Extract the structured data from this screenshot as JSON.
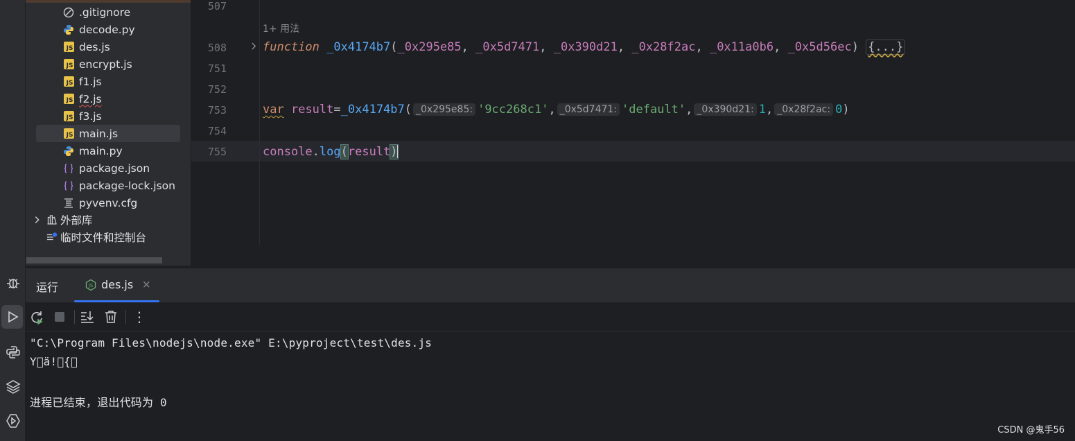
{
  "project_tree": {
    "items": [
      {
        "label": ".gitignore",
        "icon": "ignore-file-icon"
      },
      {
        "label": "decode.py",
        "icon": "python-file-icon"
      },
      {
        "label": "des.js",
        "icon": "js-file-icon"
      },
      {
        "label": "encrypt.js",
        "icon": "js-file-icon"
      },
      {
        "label": "f1.js",
        "icon": "js-file-icon"
      },
      {
        "label": "f2.js",
        "icon": "js-file-icon"
      },
      {
        "label": "f3.js",
        "icon": "js-file-icon"
      },
      {
        "label": "main.js",
        "icon": "js-file-icon",
        "selected": true
      },
      {
        "label": "main.py",
        "icon": "python-file-icon"
      },
      {
        "label": "package.json",
        "icon": "json-file-icon"
      },
      {
        "label": "package-lock.json",
        "icon": "json-file-icon"
      },
      {
        "label": "pyvenv.cfg",
        "icon": "config-file-icon"
      }
    ],
    "external_libs": "外部库",
    "scratches": "临时文件和控制台",
    "js_badge": "JS"
  },
  "editor": {
    "line_numbers": [
      "507",
      "508",
      "751",
      "752",
      "753",
      "754",
      "755"
    ],
    "usages_hint": "1+ 用法",
    "line_508": {
      "keyword": "function",
      "func_name": "_0x4174b7",
      "open_paren": "(",
      "params": [
        "_0x295e85",
        "_0x5d7471",
        "_0x390d21",
        "_0x28f2ac",
        "_0x11a0b6",
        "_0x5d56ec"
      ],
      "sep": ", ",
      "close_paren": ")",
      "folded_body": "{...}"
    },
    "line_753": {
      "keyword": "var",
      "var_name": "result",
      "assign": "=",
      "func_name": "_0x4174b7",
      "open_paren": "(",
      "hint1": "_0x295e85:",
      "arg1": "'9cc268c1'",
      "hint2": "_0x5d7471:",
      "arg2": "'default'",
      "hint3": "_0x390d21:",
      "arg3": "1",
      "hint4": "_0x28f2ac:",
      "arg4": "0",
      "comma": ",",
      "close_paren": ")"
    },
    "line_755": {
      "object": "console",
      "dot": ".",
      "method": "log",
      "open_paren": "(",
      "arg": "result",
      "close_paren": ")"
    }
  },
  "run_panel": {
    "title": "运行",
    "tab_label": "des.js",
    "tab_close": "×",
    "toolbar": [
      "rerun-icon",
      "stop-icon",
      "scroll-to-end-icon",
      "clear-all-icon",
      "more-icon"
    ],
    "more_glyph": "⋮"
  },
  "console": {
    "lines": [
      "\"C:\\Program Files\\nodejs\\node.exe\" E:\\pyproject\\test\\des.js",
      "Y\u0000ä!\u0000{\u0000",
      "",
      "进程已结束，退出代码为 0"
    ]
  },
  "left_toolbar": [
    "debug-icon",
    "run-icon",
    "python-console-icon",
    "layers-icon",
    "services-icon"
  ],
  "watermark": "CSDN @鬼手56",
  "colors": {
    "background": "#1e1f22",
    "panel": "#2b2d30",
    "accent": "#3574f0",
    "keyword": "#cf8e6d",
    "function": "#56a8f5",
    "string": "#6aab73",
    "number": "#2aacb8",
    "variable": "#c77dbb"
  }
}
